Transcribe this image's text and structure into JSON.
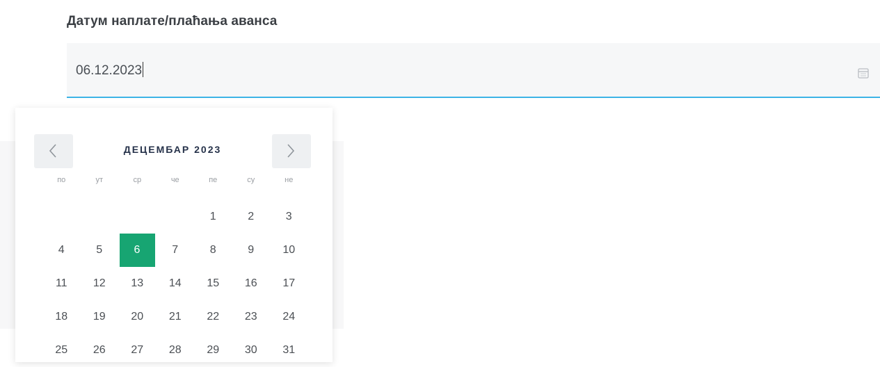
{
  "field": {
    "label": "Датум наплате/плаћања аванса",
    "value": "06.12.2023",
    "icon": "calendar-icon"
  },
  "datepicker": {
    "month_title": "ДЕЦЕМБАР 2023",
    "prev_icon": "chevron-left-icon",
    "next_icon": "chevron-right-icon",
    "weekdays": [
      "по",
      "ут",
      "ср",
      "че",
      "пе",
      "су",
      "не"
    ],
    "weeks": [
      [
        "",
        "",
        "",
        "",
        "1",
        "2",
        "3"
      ],
      [
        "4",
        "5",
        "6",
        "7",
        "8",
        "9",
        "10"
      ],
      [
        "11",
        "12",
        "13",
        "14",
        "15",
        "16",
        "17"
      ],
      [
        "18",
        "19",
        "20",
        "21",
        "22",
        "23",
        "24"
      ],
      [
        "25",
        "26",
        "27",
        "28",
        "29",
        "30",
        "31"
      ]
    ],
    "selected_day": "6",
    "selected_color": "#17a572"
  }
}
